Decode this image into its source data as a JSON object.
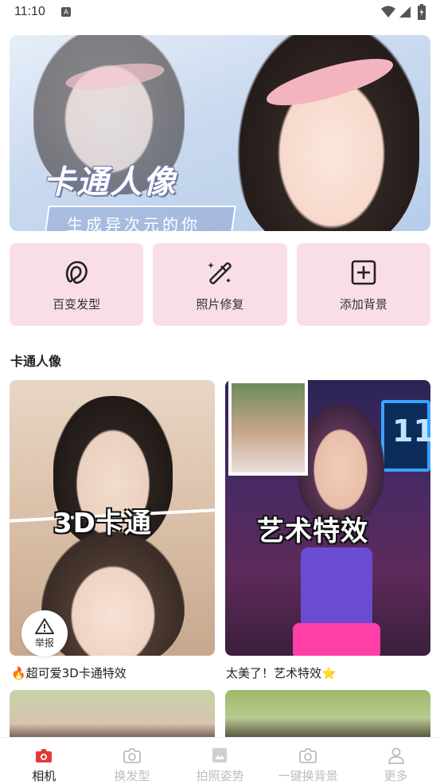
{
  "status_bar": {
    "time": "11:10",
    "notification_icon": "A"
  },
  "banner": {
    "title": "卡通人像",
    "subtitle": "生成异次元的你",
    "active_slide": 1,
    "slide_count": 4,
    "accent_color": "#f0506e"
  },
  "features": [
    {
      "label": "百变发型",
      "icon": "hair-icon"
    },
    {
      "label": "照片修复",
      "icon": "magic-wand-icon"
    },
    {
      "label": "添加背景",
      "icon": "add-box-icon"
    }
  ],
  "section": {
    "title": "卡通人像"
  },
  "cards": [
    {
      "overlay_text": "3D卡通",
      "caption": "🔥超可爱3D卡通特效"
    },
    {
      "overlay_text": "艺术特效",
      "neon_text": "11",
      "caption": "太美了！艺术特效⭐"
    }
  ],
  "report": {
    "label": "举报",
    "icon": "warning-icon"
  },
  "bottom_nav": [
    {
      "label": "相机",
      "icon": "camera-icon",
      "active": true
    },
    {
      "label": "换发型",
      "icon": "camera-icon",
      "active": false
    },
    {
      "label": "拍照姿势",
      "icon": "image-icon",
      "active": false
    },
    {
      "label": "一键换背景",
      "icon": "camera-icon",
      "active": false
    },
    {
      "label": "更多",
      "icon": "person-icon",
      "active": false
    }
  ],
  "colors": {
    "feature_bg": "#f9dfe5",
    "nav_active": "#e53935",
    "nav_inactive": "#bdbdbd"
  }
}
